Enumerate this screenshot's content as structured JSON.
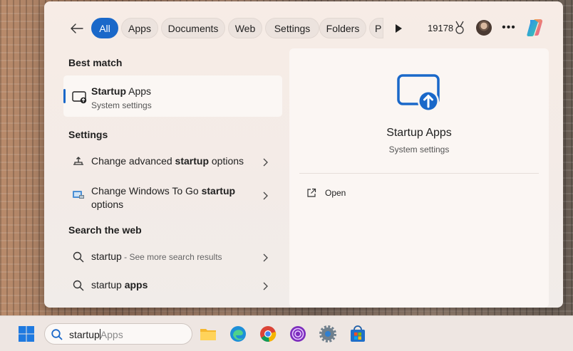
{
  "search_flyout": {
    "filters": {
      "chips": [
        {
          "label": "All",
          "active": true
        },
        {
          "label": "Apps"
        },
        {
          "label": "Documents"
        },
        {
          "label": "Web"
        },
        {
          "label": "Settings"
        },
        {
          "label": "Folders"
        },
        {
          "label": "P"
        }
      ],
      "reward_points": "19178"
    },
    "best_match": {
      "heading": "Best match",
      "item": {
        "title_bold": "Startup",
        "title_rest": " Apps",
        "subtitle": "System settings",
        "icon": "startup-apps-icon"
      }
    },
    "settings": {
      "heading": "Settings",
      "items": [
        {
          "pre": "Change advanced ",
          "bold": "startup",
          "post": " options",
          "icon": "startup-options-icon"
        },
        {
          "pre": "Change Windows To Go ",
          "bold": "startup",
          "line2": "options",
          "icon": "windows-to-go-icon"
        }
      ]
    },
    "web": {
      "heading": "Search the web",
      "items": [
        {
          "bold": "startup",
          "hint": " - See more search results"
        },
        {
          "pre": "startup ",
          "bold": "apps"
        }
      ]
    },
    "preview": {
      "title": "Startup Apps",
      "subtitle": "System settings",
      "actions": [
        {
          "label": "Open",
          "icon": "open-external-icon"
        }
      ]
    }
  },
  "taskbar": {
    "search": {
      "typed": "startup",
      "suggestion": "Apps"
    },
    "apps": [
      "file-explorer-icon",
      "edge-icon",
      "chrome-icon",
      "tor-icon",
      "settings-icon",
      "store-icon"
    ]
  },
  "colors": {
    "accent": "#1a68c9"
  }
}
